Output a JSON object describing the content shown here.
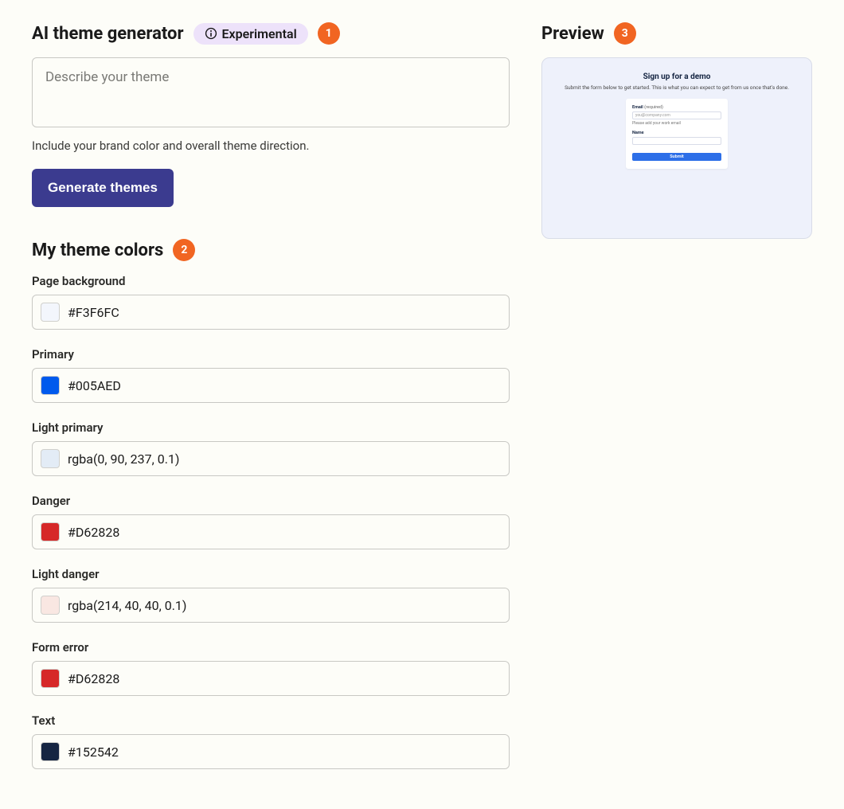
{
  "ai_section": {
    "title": "AI theme generator",
    "badge_label": "Experimental",
    "marker": "1",
    "placeholder": "Describe your theme",
    "help": "Include your brand color and overall theme direction.",
    "button": "Generate themes"
  },
  "colors_section": {
    "title": "My theme colors",
    "marker": "2",
    "fields": [
      {
        "label": "Page background",
        "value": "#F3F6FC",
        "swatch": "#F3F6FC"
      },
      {
        "label": "Primary",
        "value": "#005AED",
        "swatch": "#005AED"
      },
      {
        "label": "Light primary",
        "value": "rgba(0, 90, 237, 0.1)",
        "swatch": "rgba(0,90,237,0.1)"
      },
      {
        "label": "Danger",
        "value": "#D62828",
        "swatch": "#D62828"
      },
      {
        "label": "Light danger",
        "value": "rgba(214, 40, 40, 0.1)",
        "swatch": "rgba(214,40,40,0.1)"
      },
      {
        "label": "Form error",
        "value": "#D62828",
        "swatch": "#D62828"
      },
      {
        "label": "Text",
        "value": "#152542",
        "swatch": "#152542"
      }
    ]
  },
  "preview": {
    "title": "Preview",
    "marker": "3",
    "heading": "Sign up for a demo",
    "subtext": "Submit the form below to get started. This is what you can expect to get from us once that's done.",
    "email_label": "Email",
    "required": "(required)",
    "email_placeholder": "you@company.com",
    "email_help": "Please add your work email",
    "name_label": "Name",
    "submit": "Submit"
  }
}
